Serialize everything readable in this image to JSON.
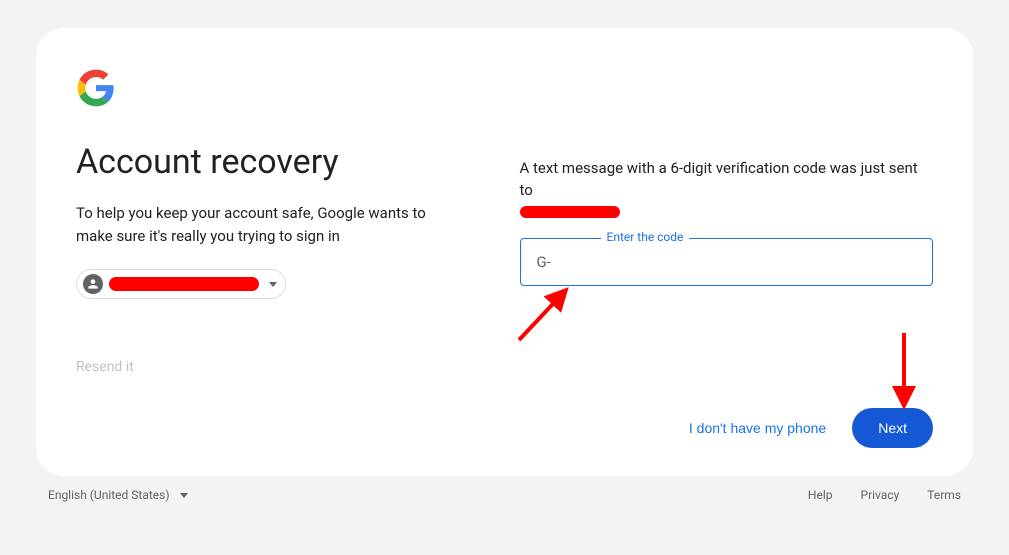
{
  "header": {
    "title": "Account recovery",
    "subtitle": "To help you keep your account safe, Google wants to make sure it's really you trying to sign in"
  },
  "resend_label": "Resend it",
  "right": {
    "sms_text": "A text message with a 6-digit verification code was just sent to",
    "code_label": "Enter the code",
    "code_prefix": "G-",
    "no_phone_label": "I don't have my phone",
    "next_label": "Next"
  },
  "footer": {
    "language": "English (United States)",
    "help": "Help",
    "privacy": "Privacy",
    "terms": "Terms"
  },
  "colors": {
    "primary": "#1a73e8",
    "redaction": "#ff0000"
  }
}
